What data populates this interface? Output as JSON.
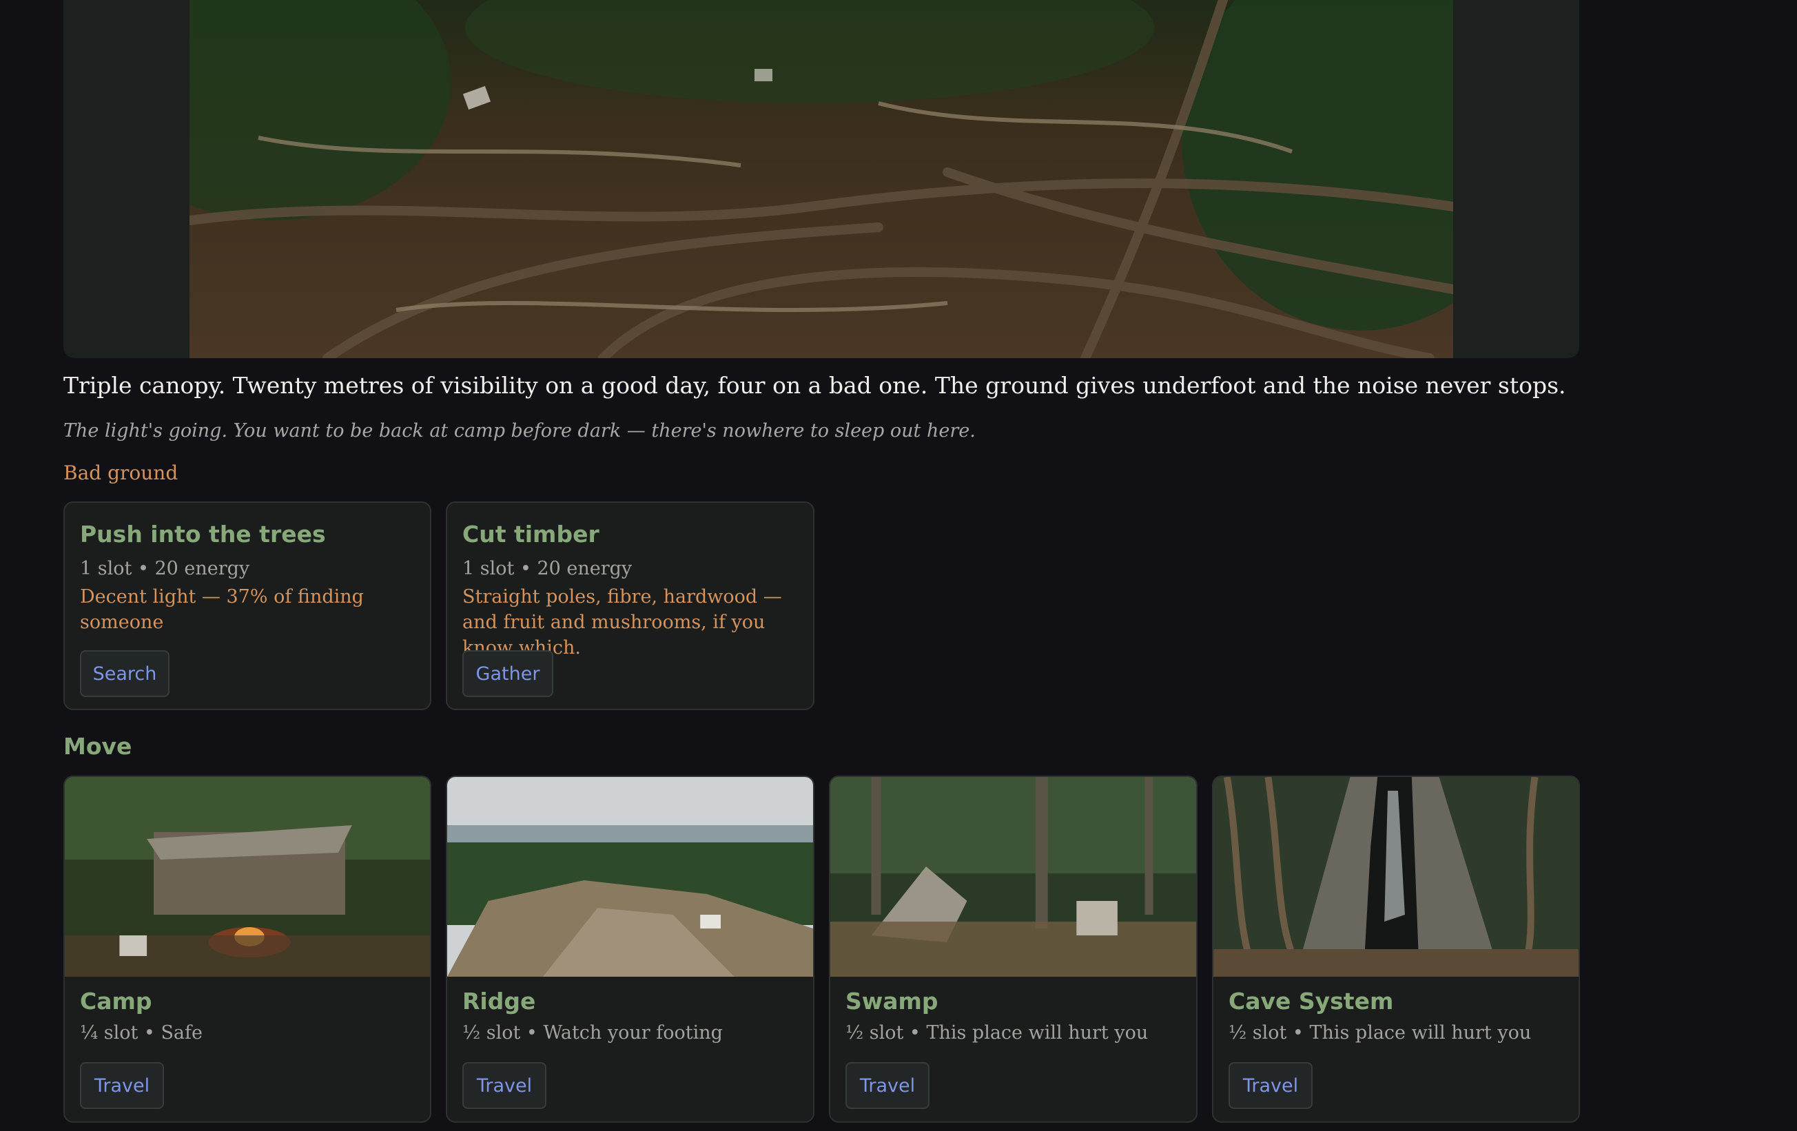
{
  "location": {
    "description": "Triple canopy. Twenty metres of visibility on a good day, four on a bad one. The ground gives underfoot and the noise never stops.",
    "flavor": "The light's going. You want to be back at camp before dark — there's nowhere to sleep out here.",
    "status": "Bad ground"
  },
  "actions": [
    {
      "title": "Push into the trees",
      "meta": "1 slot • 20 energy",
      "note": "Decent light — 37% of finding someone",
      "button": "Search"
    },
    {
      "title": "Cut timber",
      "meta": "1 slot • 20 energy",
      "note": "Straight poles, fibre, hardwood — and fruit and mushrooms, if you know which.",
      "button": "Gather"
    }
  ],
  "move": {
    "title": "Move",
    "destinations": [
      {
        "name": "Camp",
        "meta": "¼ slot • Safe",
        "button": "Travel"
      },
      {
        "name": "Ridge",
        "meta": "½ slot • Watch your footing",
        "button": "Travel"
      },
      {
        "name": "Swamp",
        "meta": "½ slot • This place will hurt you",
        "button": "Travel"
      },
      {
        "name": "Cave System",
        "meta": "½ slot • This place will hurt you",
        "button": "Travel"
      }
    ]
  },
  "colors": {
    "background": "#111014",
    "card": "#1a1d1c",
    "accent_green": "#87a97a",
    "warning_orange": "#d7935a",
    "link_blue": "#7d96e8"
  }
}
